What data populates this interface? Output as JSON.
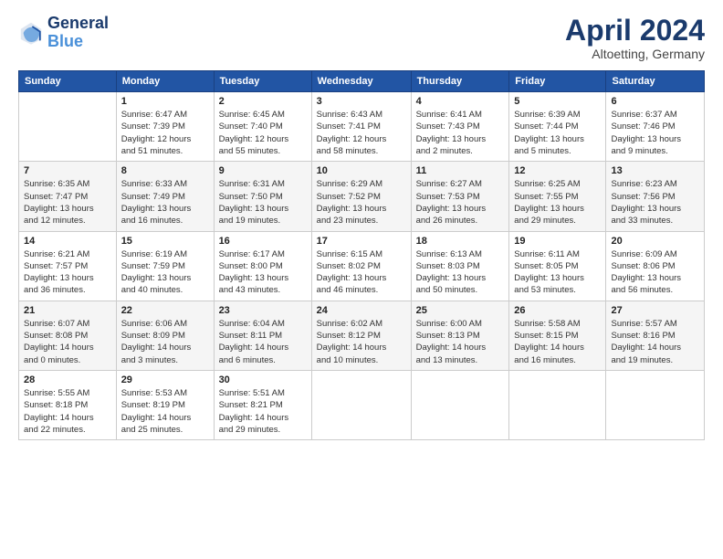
{
  "header": {
    "logo_line1": "General",
    "logo_line2": "Blue",
    "month_title": "April 2024",
    "subtitle": "Altoetting, Germany"
  },
  "weekdays": [
    "Sunday",
    "Monday",
    "Tuesday",
    "Wednesday",
    "Thursday",
    "Friday",
    "Saturday"
  ],
  "weeks": [
    [
      {
        "day": "",
        "info": ""
      },
      {
        "day": "1",
        "info": "Sunrise: 6:47 AM\nSunset: 7:39 PM\nDaylight: 12 hours\nand 51 minutes."
      },
      {
        "day": "2",
        "info": "Sunrise: 6:45 AM\nSunset: 7:40 PM\nDaylight: 12 hours\nand 55 minutes."
      },
      {
        "day": "3",
        "info": "Sunrise: 6:43 AM\nSunset: 7:41 PM\nDaylight: 12 hours\nand 58 minutes."
      },
      {
        "day": "4",
        "info": "Sunrise: 6:41 AM\nSunset: 7:43 PM\nDaylight: 13 hours\nand 2 minutes."
      },
      {
        "day": "5",
        "info": "Sunrise: 6:39 AM\nSunset: 7:44 PM\nDaylight: 13 hours\nand 5 minutes."
      },
      {
        "day": "6",
        "info": "Sunrise: 6:37 AM\nSunset: 7:46 PM\nDaylight: 13 hours\nand 9 minutes."
      }
    ],
    [
      {
        "day": "7",
        "info": "Sunrise: 6:35 AM\nSunset: 7:47 PM\nDaylight: 13 hours\nand 12 minutes."
      },
      {
        "day": "8",
        "info": "Sunrise: 6:33 AM\nSunset: 7:49 PM\nDaylight: 13 hours\nand 16 minutes."
      },
      {
        "day": "9",
        "info": "Sunrise: 6:31 AM\nSunset: 7:50 PM\nDaylight: 13 hours\nand 19 minutes."
      },
      {
        "day": "10",
        "info": "Sunrise: 6:29 AM\nSunset: 7:52 PM\nDaylight: 13 hours\nand 23 minutes."
      },
      {
        "day": "11",
        "info": "Sunrise: 6:27 AM\nSunset: 7:53 PM\nDaylight: 13 hours\nand 26 minutes."
      },
      {
        "day": "12",
        "info": "Sunrise: 6:25 AM\nSunset: 7:55 PM\nDaylight: 13 hours\nand 29 minutes."
      },
      {
        "day": "13",
        "info": "Sunrise: 6:23 AM\nSunset: 7:56 PM\nDaylight: 13 hours\nand 33 minutes."
      }
    ],
    [
      {
        "day": "14",
        "info": "Sunrise: 6:21 AM\nSunset: 7:57 PM\nDaylight: 13 hours\nand 36 minutes."
      },
      {
        "day": "15",
        "info": "Sunrise: 6:19 AM\nSunset: 7:59 PM\nDaylight: 13 hours\nand 40 minutes."
      },
      {
        "day": "16",
        "info": "Sunrise: 6:17 AM\nSunset: 8:00 PM\nDaylight: 13 hours\nand 43 minutes."
      },
      {
        "day": "17",
        "info": "Sunrise: 6:15 AM\nSunset: 8:02 PM\nDaylight: 13 hours\nand 46 minutes."
      },
      {
        "day": "18",
        "info": "Sunrise: 6:13 AM\nSunset: 8:03 PM\nDaylight: 13 hours\nand 50 minutes."
      },
      {
        "day": "19",
        "info": "Sunrise: 6:11 AM\nSunset: 8:05 PM\nDaylight: 13 hours\nand 53 minutes."
      },
      {
        "day": "20",
        "info": "Sunrise: 6:09 AM\nSunset: 8:06 PM\nDaylight: 13 hours\nand 56 minutes."
      }
    ],
    [
      {
        "day": "21",
        "info": "Sunrise: 6:07 AM\nSunset: 8:08 PM\nDaylight: 14 hours\nand 0 minutes."
      },
      {
        "day": "22",
        "info": "Sunrise: 6:06 AM\nSunset: 8:09 PM\nDaylight: 14 hours\nand 3 minutes."
      },
      {
        "day": "23",
        "info": "Sunrise: 6:04 AM\nSunset: 8:11 PM\nDaylight: 14 hours\nand 6 minutes."
      },
      {
        "day": "24",
        "info": "Sunrise: 6:02 AM\nSunset: 8:12 PM\nDaylight: 14 hours\nand 10 minutes."
      },
      {
        "day": "25",
        "info": "Sunrise: 6:00 AM\nSunset: 8:13 PM\nDaylight: 14 hours\nand 13 minutes."
      },
      {
        "day": "26",
        "info": "Sunrise: 5:58 AM\nSunset: 8:15 PM\nDaylight: 14 hours\nand 16 minutes."
      },
      {
        "day": "27",
        "info": "Sunrise: 5:57 AM\nSunset: 8:16 PM\nDaylight: 14 hours\nand 19 minutes."
      }
    ],
    [
      {
        "day": "28",
        "info": "Sunrise: 5:55 AM\nSunset: 8:18 PM\nDaylight: 14 hours\nand 22 minutes."
      },
      {
        "day": "29",
        "info": "Sunrise: 5:53 AM\nSunset: 8:19 PM\nDaylight: 14 hours\nand 25 minutes."
      },
      {
        "day": "30",
        "info": "Sunrise: 5:51 AM\nSunset: 8:21 PM\nDaylight: 14 hours\nand 29 minutes."
      },
      {
        "day": "",
        "info": ""
      },
      {
        "day": "",
        "info": ""
      },
      {
        "day": "",
        "info": ""
      },
      {
        "day": "",
        "info": ""
      }
    ]
  ]
}
